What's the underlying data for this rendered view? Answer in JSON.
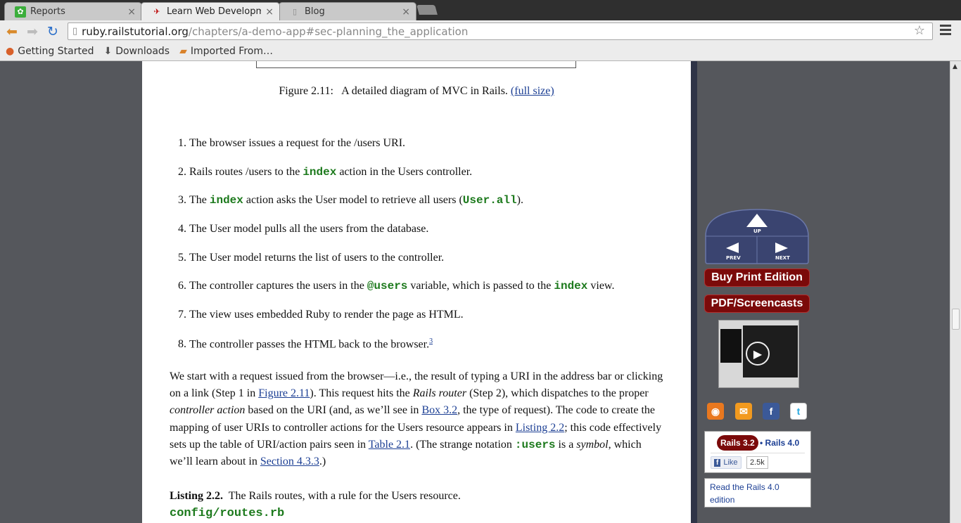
{
  "browser": {
    "tabs": [
      {
        "title": "Reports",
        "icon": "reports-icon",
        "active": false
      },
      {
        "title": "Learn Web Development",
        "icon": "rails-icon",
        "active": true
      },
      {
        "title": "Blog",
        "icon": "page-icon",
        "active": false
      }
    ],
    "url_domain": "ruby.railstutorial.org",
    "url_path": "/chapters/a-demo-app#sec-planning_the_application",
    "bookmarks": [
      {
        "label": "Getting Started",
        "icon": "firefox-icon"
      },
      {
        "label": "Downloads",
        "icon": "download-icon"
      },
      {
        "label": "Imported From…",
        "icon": "folder-icon"
      }
    ]
  },
  "article": {
    "figure_caption": "Figure 2.11:   A detailed diagram of MVC in Rails.",
    "figure_link": "(full size)",
    "steps": [
      {
        "num": "1.",
        "parts": [
          {
            "t": "The browser issues a request for the /users URI."
          }
        ]
      },
      {
        "num": "2.",
        "parts": [
          {
            "t": "Rails routes /users to the "
          },
          {
            "t": "index",
            "code": true
          },
          {
            "t": " action in the Users controller."
          }
        ]
      },
      {
        "num": "3.",
        "parts": [
          {
            "t": "The "
          },
          {
            "t": "index",
            "code": true
          },
          {
            "t": " action asks the User model to retrieve all users ("
          },
          {
            "t": "User.all",
            "code": true
          },
          {
            "t": ")."
          }
        ]
      },
      {
        "num": "4.",
        "parts": [
          {
            "t": "The User model pulls all the users from the database."
          }
        ]
      },
      {
        "num": "5.",
        "parts": [
          {
            "t": "The User model returns the list of users to the controller."
          }
        ]
      },
      {
        "num": "6.",
        "parts": [
          {
            "t": "The controller captures the users in the "
          },
          {
            "t": "@users",
            "code": true
          },
          {
            "t": " variable, which is passed to the "
          },
          {
            "t": "index",
            "code": true
          },
          {
            "t": " view."
          }
        ]
      },
      {
        "num": "7.",
        "parts": [
          {
            "t": "The view uses embedded Ruby to render the page as HTML."
          }
        ]
      },
      {
        "num": "8.",
        "parts": [
          {
            "t": "The controller passes the HTML back to the browser."
          },
          {
            "t": "3",
            "sup": true
          }
        ]
      }
    ],
    "paragraph": {
      "p1": "We start with a request issued from the browser—i.e., the result of typing a URI in the address bar or clicking on a link (Step 1 in ",
      "link1": "Figure 2.11",
      "p2": "). This request hits the ",
      "em1": "Rails router",
      "p3": " (Step 2), which dispatches to the proper ",
      "em2": "controller action",
      "p4": " based on the URI (and, as we’ll see in ",
      "link2": "Box 3.2",
      "p5": ", the type of request). The code to create the mapping of user URIs to controller actions for the Users resource appears in ",
      "link3": "Listing 2.2",
      "p6": "; this code effectively sets up the table of URI/action pairs seen in ",
      "link4": "Table 2.1",
      "p7": ". (The strange notation ",
      "code1": ":users",
      "p8": " is a ",
      "em3": "symbol",
      "p9": ", which we’ll learn about in ",
      "link5": "Section 4.3.3",
      "p10": ".)"
    },
    "listing_label": "Listing 2.2.",
    "listing_text": "  The Rails routes, with a rule for the Users resource.",
    "listing_file": "config/routes.rb"
  },
  "sidebar": {
    "nav_up": "UP",
    "nav_prev": "PREV",
    "nav_next": "NEXT",
    "buy_print": "Buy Print Edition",
    "pdf_screencasts": "PDF/Screencasts",
    "social": [
      "rss-icon",
      "email-icon",
      "facebook-icon",
      "twitter-icon"
    ],
    "rails32": "Rails 3.2",
    "rails40": "• Rails 4.0",
    "fb_like": "Like",
    "fb_count": "2.5k",
    "read_rails40": "Read the Rails 4.0 edition"
  },
  "colors": {
    "accent_red": "#7b0a0a",
    "link_blue": "#1c3f94",
    "code_green": "#1d7a1d",
    "nav_navy": "#3a4470"
  }
}
